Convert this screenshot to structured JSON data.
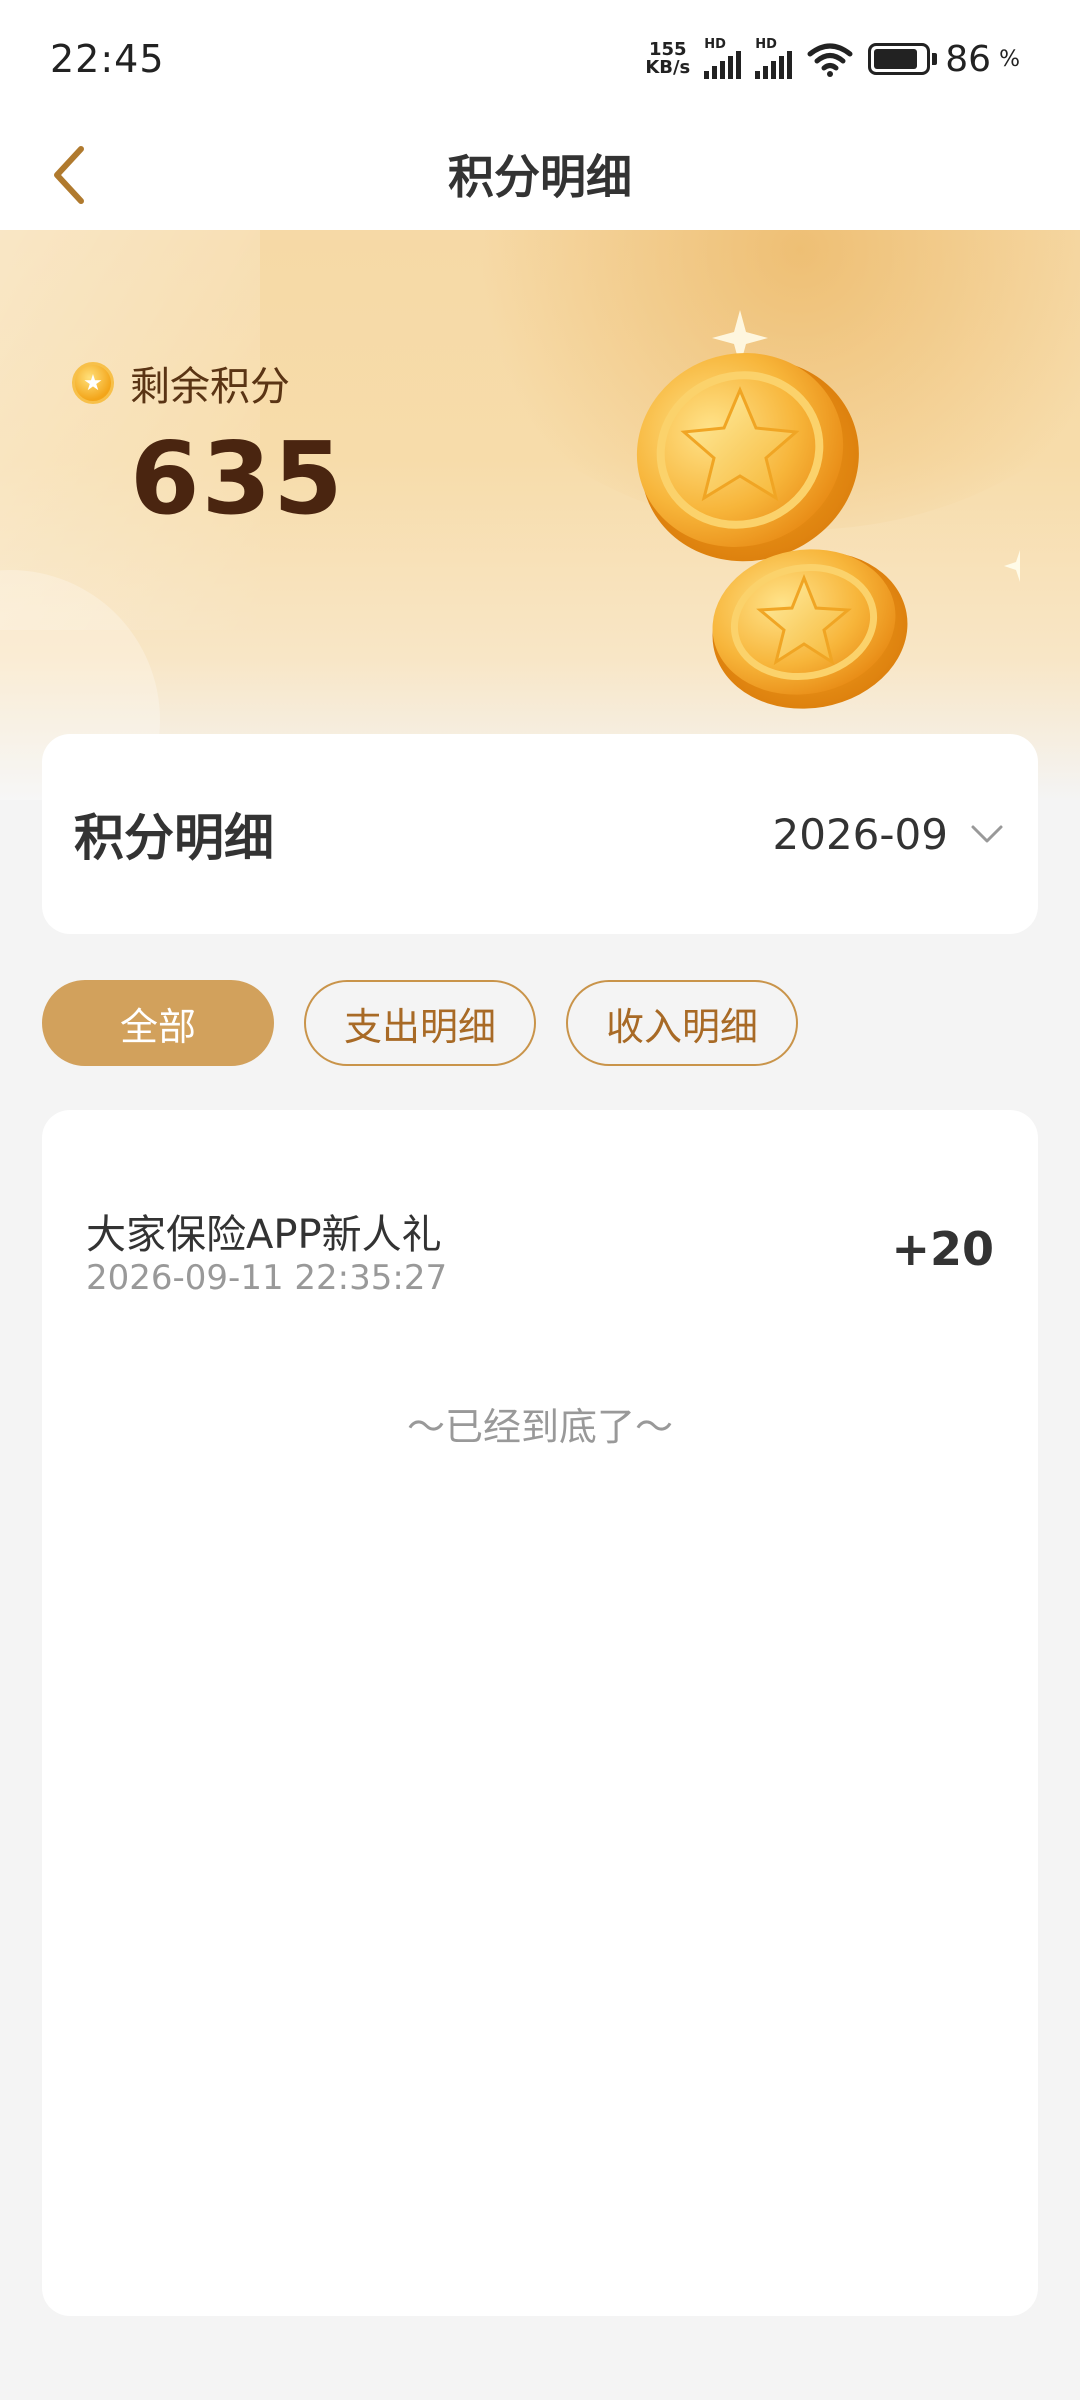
{
  "status_bar": {
    "time": "22:45",
    "net_speed_value": "155",
    "net_speed_unit": "KB/s",
    "hd_label_1": "HD",
    "hd_label_2": "HD",
    "battery_percent": "86",
    "battery_symbol": "%"
  },
  "nav": {
    "title": "积分明细",
    "back_icon": "chevron-left-icon"
  },
  "banner": {
    "label": "剩余积分",
    "points": "635",
    "coin_icon": "star-coin-icon"
  },
  "month_filter": {
    "title": "积分明细",
    "value": "2026-09",
    "dropdown_icon": "chevron-down-icon"
  },
  "tabs": [
    {
      "label": "全部",
      "active": true
    },
    {
      "label": "支出明细",
      "active": false
    },
    {
      "label": "收入明细",
      "active": false
    }
  ],
  "records": [
    {
      "title": "大家保险APP新人礼",
      "time": "2026-09-11 22:35:27",
      "amount": "+20"
    }
  ],
  "end_text": "～已经到底了～",
  "colors": {
    "accent": "#d2a15c",
    "accent_text": "#a86a26",
    "points_text": "#4a2510",
    "background": "#f4f4f4"
  }
}
